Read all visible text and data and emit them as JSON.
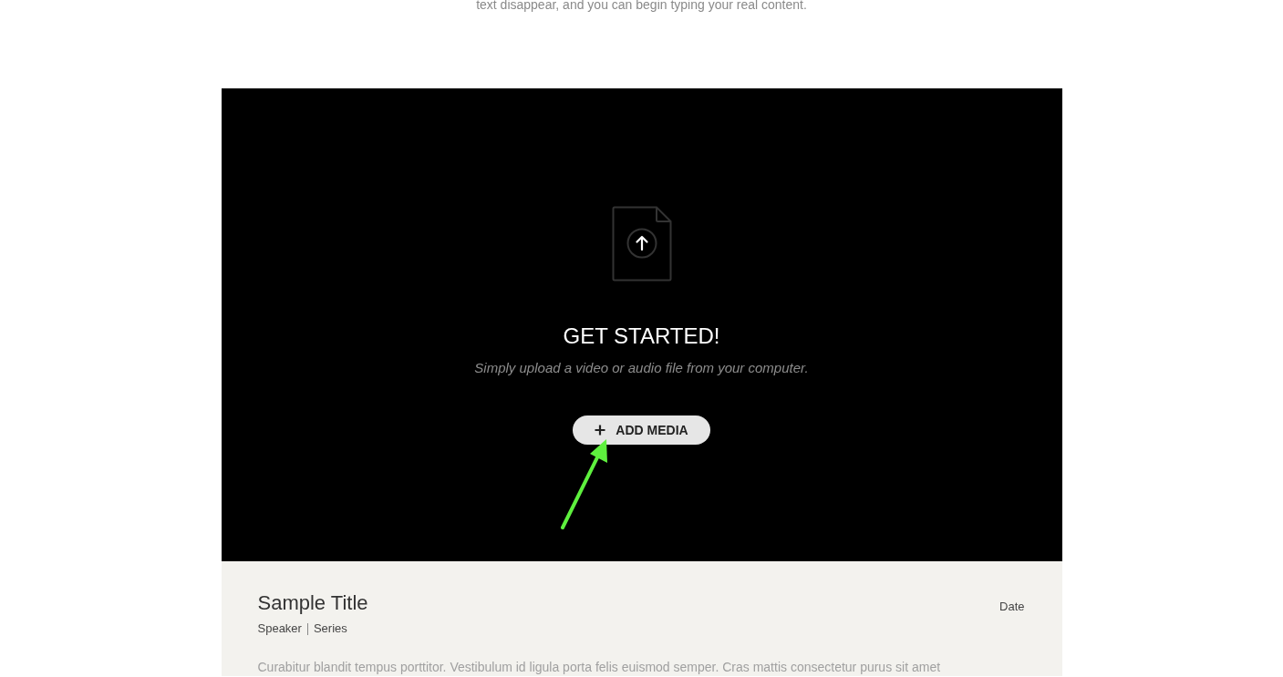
{
  "intro_text": "text disappear, and you can begin typing your real content.",
  "media_panel": {
    "heading": "GET STARTED!",
    "subtitle": "Simply upload a video or audio file from your computer.",
    "button": {
      "label": "ADD MEDIA"
    }
  },
  "details": {
    "title": "Sample Title",
    "speaker": "Speaker",
    "series": "Series",
    "date": "Date",
    "description": "Curabitur blandit tempus porttitor. Vestibulum id ligula porta felis euismod semper. Cras mattis consectetur purus sit amet"
  }
}
